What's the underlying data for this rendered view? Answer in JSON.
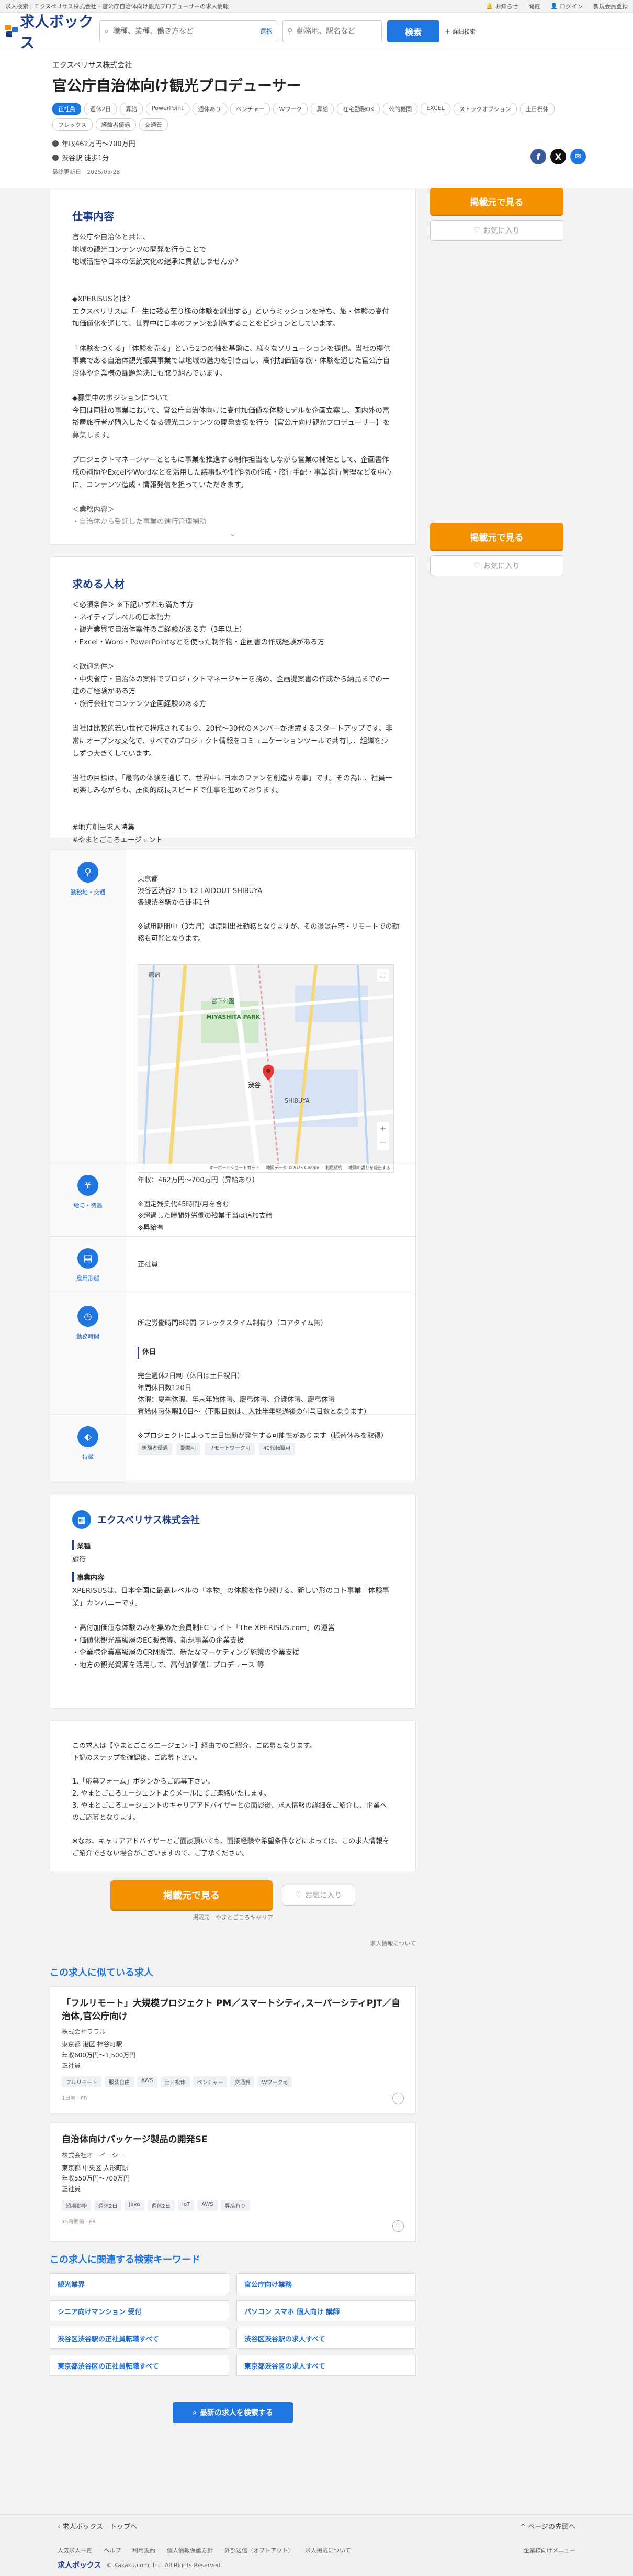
{
  "topbar": {
    "breadcrumb": "求人検索 | エクスペリサス株式会社 - 官公庁自治体向け観光プロデューサーの求人情報",
    "links": [
      "お知らせ",
      "閲覧",
      "ログイン",
      "新規会員登録"
    ]
  },
  "header": {
    "logo": "求人ボックス",
    "keyword_placeholder": "職種、業種、働き方など",
    "keyword_select": "選択",
    "location_placeholder": "勤務地、駅名など",
    "location_select": "選択",
    "search_button": "検索",
    "detail_conditions": "詳細検索"
  },
  "job": {
    "company": "エクスペリサス株式会社",
    "title": "官公庁自治体向け観光プロデューサー",
    "tags": [
      "正社員",
      "週休2日",
      "昇給",
      "PowerPoint",
      "週休あり",
      "ベンチャー",
      "Wワーク",
      "昇給",
      "在宅勤務OK",
      "公的機関",
      "EXCEL",
      "ストックオプション",
      "土日祝休",
      "フレックス",
      "経験者優遇",
      "交通費"
    ],
    "salary": "年収462万円〜700万円",
    "location": "渋谷駅 徒歩1分",
    "updated": "最終更新日　2025/05/28"
  },
  "share": {
    "facebook": "f",
    "x": "X",
    "mail": "✉"
  },
  "side": {
    "apply": "掲載元で見る",
    "favorite": "お気に入り"
  },
  "work": {
    "title": "仕事内容",
    "body": "官公庁や自治体と共に、\n地域の観光コンテンツの開発を行うことで\n地域活性や日本の伝統文化の継承に貢献しませんか？\n\n\n◆XPERISUSとは？\nエクスペリサスは「一生に残る至り極の体験を創出する」というミッションを持ち、旅・体験の高付加価値化を通じて、世界中に日本のファンを創造することをビジョンとしています。\n\n「体験をつくる」「体験を売る」という2つの軸を基盤に、様々なソリューションを提供。当社の提供事業である自治体観光振興事業では地域の魅力を引き出し、高付加価値な旅・体験を通じた官公庁自治体や企業様の課題解決にも取り組んでいます。\n\n◆募集中のポジションについて\n今回は同社の事業において、官公庁自治体向けに高付加価値な体験モデルを企画立案し、国内外の富裕層旅行者が購入したくなる観光コンテンツの開発支援を行う【官公庁向け観光プロデューサー】を募集します。\n\nプロジェクトマネージャーとともに事業を推進する制作担当をしながら営業の補佐として、企画書作成の補助やExcelやWordなどを活用した議事録や制作物の作成・旅行手配・事業進行管理などを中心に、コンテンツ造成・情報発信を担っていただきます。\n\n＜業務内容＞\n・自治体から受託した事業の進行管理補助",
    "more": "⌄"
  },
  "requirements": {
    "title": "求める人材",
    "body": "＜必須条件＞ ※下記いずれも満たす方\n・ネイティブレベルの日本語力\n・観光業界で自治体案件のご経験がある方（3年以上）\n・Excel・Word・PowerPointなどを使った制作物・企画書の作成経験がある方\n\n＜歓迎条件＞\n・中央省庁・自治体の案件でプロジェクトマネージャーを務め、企画提案書の作成から納品までの一連のご経験がある方\n・旅行会社でコンテンツ企画経験のある方\n\n当社は比較的若い世代で構成されており、20代〜30代のメンバーが活躍するスタートアップです。非常にオープンな文化で、すべてのプロジェクト情報をコミュニケーションツールで共有し、組織を少しずつ大きくしています。\n\n当社の目標は、「最高の体験を通じて、世界中に日本のファンを創造する事」です。その為に、社員一同楽しみながらも、圧倒的成長スピードで仕事を進めております。\n\n\n#地方創生求人特集\n#やまとごころエージェント"
  },
  "info": {
    "access_label": "勤務地・交通",
    "access": "東京都\n渋谷区渋谷2-15-12 LAIDOUT SHIBUYA\n各線渋谷駅から徒歩1分\n\n※試用期間中（3カ月）は原則出社勤務となりますが、その後は在宅・リモートでの勤務も可能となります。",
    "salary_label": "給与・待遇",
    "salary": "年収：462万円〜700万円（昇給あり）\n\n※固定残業代45時間/月を含む\n※超過した時間外労働の残業手当は追加支給\n※昇給有",
    "employment_label": "雇用形態",
    "employment": "正社員",
    "hours_label": "勤務時間",
    "hours_head": "所定労働時間8時間 フレックスタイム制有り（コアタイム無）",
    "holiday_title": "休日",
    "holiday": "完全週休2日制（休日は土日祝日）\n年間休日数120日\n休暇：夏季休暇、年末年始休暇、慶弔休暇、介護休暇、慶弔休暇\n有給休暇休暇10日〜（下限日数は、入社半年経過後の付与日数となります）\n\n※プロジェクトによって土日出勤が発生する可能性があります（振替休みを取得）",
    "feature_label": "特徴",
    "features": [
      "経験者優遇",
      "副業可",
      "リモートワーク可",
      "40代転職可"
    ]
  },
  "map": {
    "labels": [
      "原宿",
      "宮下公園",
      "渋谷",
      "MIYASHITA PARK",
      "SHIBUYA"
    ],
    "footer": [
      "キーボードショートカット",
      "地図データ ©2025 Google",
      "利用規約",
      "地図の誤りを報告する"
    ]
  },
  "company_card": {
    "name": "エクスペリサス株式会社",
    "industry_title": "業種",
    "industry": "旅行",
    "business_title": "事業内容",
    "business": "XPERISUSは、日本全国に最高レベルの「本物」の体験を作り続ける、新しい形のコト事業「体験事業」カンパニーです。\n\n・高付加価値な体験のみを集めた会員制EC サイト「The XPERISUS.com」の運営\n・価値化観光高級層のEC販売等、新規事業の企業支援\n・企業様企業高級層のCRM販売、新たなマーケティング施策の企業支援\n・地方の観光資源を活用して、高付加価値にプロデュース 等"
  },
  "agent": {
    "body": "この求人は【やまとごころエージェント】経由でのご紹介、ご応募となります。\n下記のステップを確認後、ご応募下さい。\n\n1.「応募フォーム」ボタンからご応募下さい。\n2. やまとごころエージェントよりメールにてご連絡いたします。\n3. やまとごころエージェントのキャリアアドバイザーとの面談後、求人情報の詳細をご紹介し、企業へのご応募となります。\n\n※なお、キャリアアドバイザーとご面談頂いても、面接経験や希望条件などによっては、この求人情報をご紹介できない場合がございますので、ご了承ください。"
  },
  "bottom_apply": {
    "apply": "掲載元で見る",
    "favorite": "お気に入り",
    "source": "掲載元　やまとごころキャリア",
    "report": "求人情報について"
  },
  "similar": {
    "title": "この求人に似ている求人",
    "items": [
      {
        "title": "「フルリモート」大規模プロジェクト PM／スマートシティ,スーパーシティPJT／自治体,官公庁向け",
        "company": "株式会社ララル",
        "location": "東京都 港区 神谷町駅",
        "salary": "年収600万円〜1,500万円",
        "type": "正社員",
        "tags": [
          "フルリモート",
          "服装自由",
          "AWS",
          "土日祝休",
          "ベンチャー",
          "交通費",
          "Wワーク可"
        ],
        "foot": "1日前 · PR"
      },
      {
        "title": "自治体向けパッケージ製品の開発SE",
        "company": "株式会社オーイーシー",
        "location": "東京都 中央区 人形町駅",
        "salary": "年収550万円〜700万円",
        "type": "正社員",
        "tags": [
          "短期勤務",
          "週休2日",
          "Java",
          "週休2日",
          "IoT",
          "AWS",
          "昇給有り"
        ],
        "foot": "15時間前 · PR"
      }
    ]
  },
  "keywords": {
    "title": "この求人に関連する検索キーワード",
    "items": [
      "観光業界",
      "官公庁向け業務",
      "シニア向けマンション 受付",
      "パソコン スマホ 個人向け 講師",
      "渋谷区渋谷駅の正社員転職すべて",
      "渋谷区渋谷駅の求人すべて",
      "東京都渋谷区の正社員転職すべて",
      "東京都渋谷区の求人すべて"
    ],
    "more_button": "最新の求人を検索する"
  },
  "footer": {
    "back": "求人ボックス　トップへ",
    "top": "ページの先頭へ",
    "links": [
      "人気求人一覧",
      "ヘルプ",
      "利用規約",
      "個人情報保護方針",
      "外部送信（オプトアウト）",
      "求人掲載について",
      "採用担当者様へ"
    ],
    "partner": "企業様向けメニュー",
    "logo": "求人ボックス",
    "copyright": "© Kakaku.com, Inc. All Rights Reserved."
  }
}
